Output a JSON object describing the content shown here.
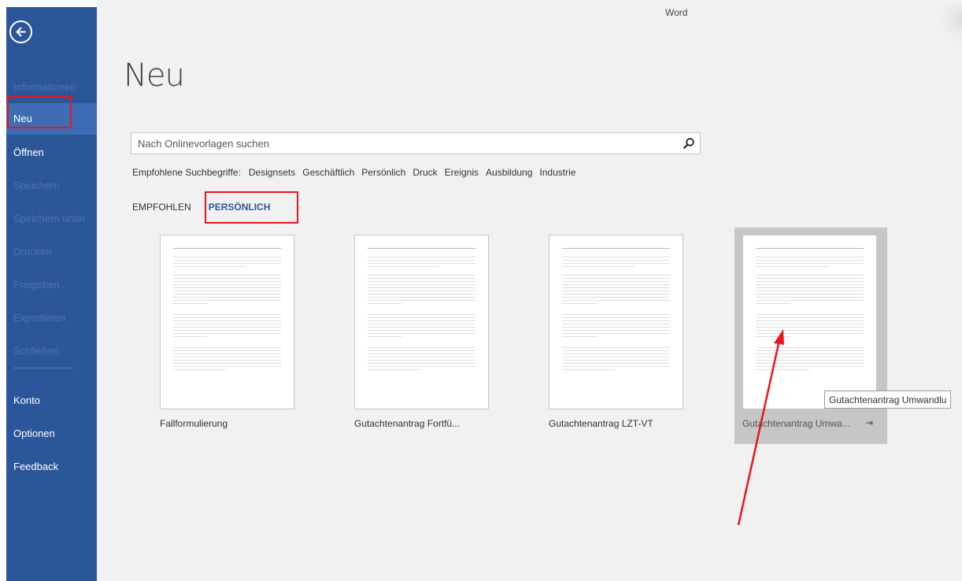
{
  "app": {
    "name": "Word"
  },
  "sidebar": {
    "items": [
      {
        "label": "Informationen",
        "enabled": false
      },
      {
        "label": "Neu",
        "enabled": true,
        "active": true
      },
      {
        "label": "Öffnen",
        "enabled": true
      },
      {
        "label": "Speichern",
        "enabled": false
      },
      {
        "label": "Speichern unter",
        "enabled": false
      },
      {
        "label": "Drucken",
        "enabled": false
      },
      {
        "label": "Freigeben",
        "enabled": false
      },
      {
        "label": "Exportieren",
        "enabled": false
      },
      {
        "label": "Schließen",
        "enabled": false
      },
      {
        "label": "Konto",
        "enabled": true
      },
      {
        "label": "Optionen",
        "enabled": true
      },
      {
        "label": "Feedback",
        "enabled": true
      }
    ]
  },
  "main": {
    "title": "Neu",
    "search": {
      "placeholder": "Nach Onlinevorlagen suchen",
      "value": ""
    },
    "suggestions": {
      "label": "Empfohlene Suchbegriffe:",
      "terms": [
        "Designsets",
        "Geschäftlich",
        "Persönlich",
        "Druck",
        "Ereignis",
        "Ausbildung",
        "Industrie"
      ]
    },
    "tabs": [
      {
        "label": "EMPFOHLEN",
        "active": false
      },
      {
        "label": "PERSÖNLICH",
        "active": true
      }
    ],
    "templates": [
      {
        "name": "Fallformulierung",
        "selected": false
      },
      {
        "name": "Gutachtenantrag Fortfü...",
        "selected": false
      },
      {
        "name": "Gutachtenantrag LZT-VT",
        "selected": false
      },
      {
        "name": "Gutachtenantrag Umwa...",
        "selected": true
      }
    ],
    "tooltip": "Gutachtenantrag Umwandlu"
  },
  "colors": {
    "sidebar_bg": "#2b579a",
    "sidebar_active": "#3e6db5",
    "accent": "#2b579a",
    "annotation_red": "#e8161e",
    "main_bg": "#f1f1f1"
  },
  "icons": {
    "back": "arrow-left-circle-icon",
    "search": "magnifier-icon",
    "pin": "pin-icon"
  }
}
